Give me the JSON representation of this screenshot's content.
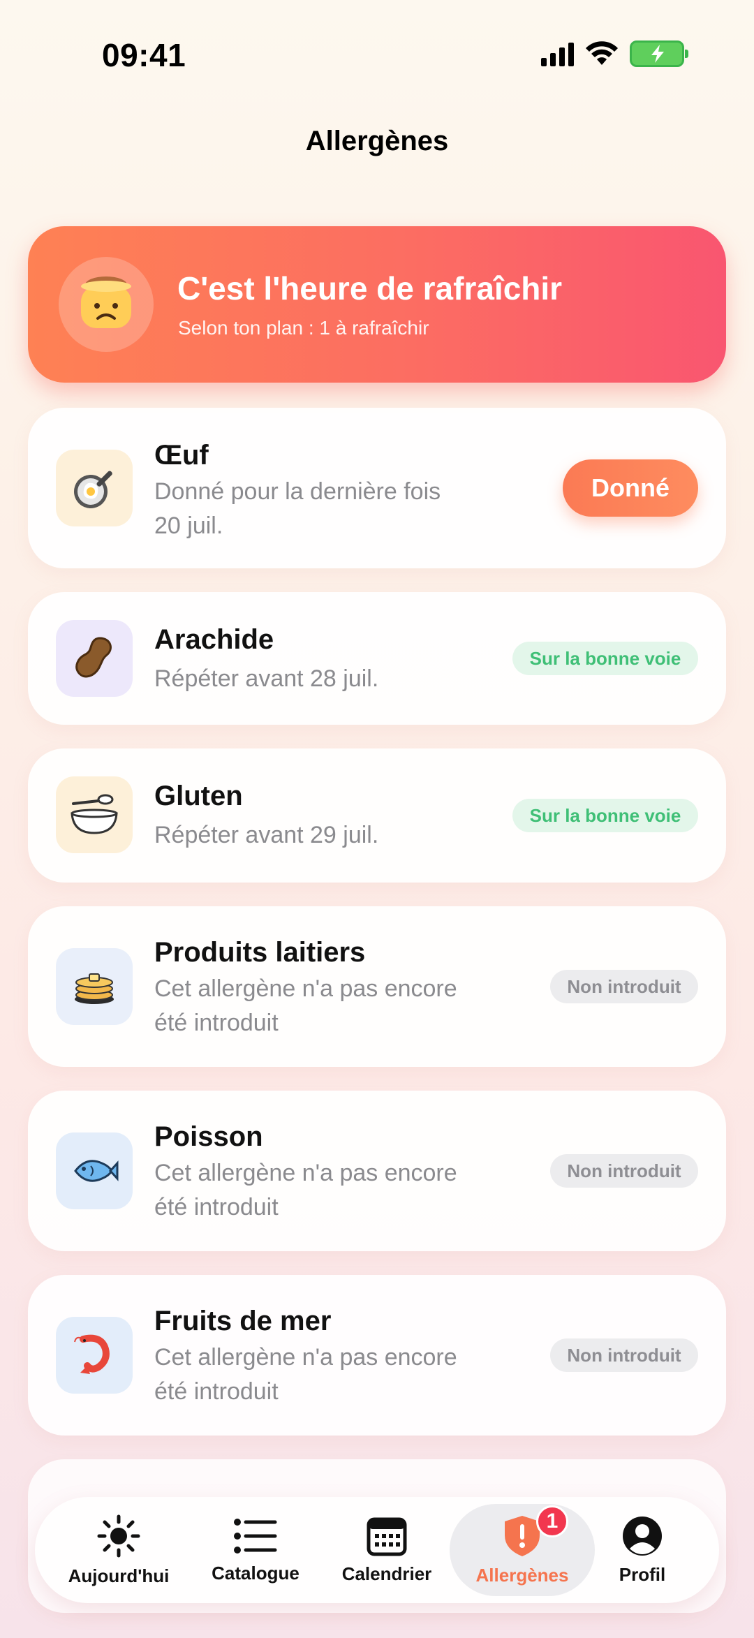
{
  "status_bar": {
    "time": "09:41"
  },
  "header": {
    "title": "Allergènes"
  },
  "banner": {
    "title": "C'est l'heure de rafraîchir",
    "subtitle": "Selon ton plan : 1 à rafraîchir",
    "icon": "sad-face-icon"
  },
  "allergens": [
    {
      "name": "Œuf",
      "desc_line1": "Donné pour la dernière fois",
      "desc_line2": "20 juil.",
      "action": "Donné",
      "icon": "frying-pan-egg-icon",
      "icon_bg": "#fdf0d9"
    },
    {
      "name": "Arachide",
      "desc_line1": "Répéter avant 28 juil.",
      "status": "Sur la bonne voie",
      "icon": "peanut-icon",
      "icon_bg": "#ede8fb"
    },
    {
      "name": "Gluten",
      "desc_line1": "Répéter avant 29 juil.",
      "status": "Sur la bonne voie",
      "icon": "bowl-spoon-icon",
      "icon_bg": "#fdf0d9"
    },
    {
      "name": "Produits laitiers",
      "desc_line1": "Cet allergène n'a pas encore",
      "desc_line2": "été introduit",
      "status": "Non introduit",
      "icon": "pancakes-icon",
      "icon_bg": "#e9effa"
    },
    {
      "name": "Poisson",
      "desc_line1": "Cet allergène n'a pas encore",
      "desc_line2": "été introduit",
      "status": "Non introduit",
      "icon": "fish-icon",
      "icon_bg": "#e3edfa"
    },
    {
      "name": "Fruits de mer",
      "desc_line1": "Cet allergène n'a pas encore",
      "desc_line2": "été introduit",
      "status": "Non introduit",
      "icon": "shrimp-icon",
      "icon_bg": "#e3edfa"
    }
  ],
  "tabbar": {
    "tabs": [
      {
        "label": "Aujourd'hui",
        "icon": "sun-icon"
      },
      {
        "label": "Catalogue",
        "icon": "list-icon"
      },
      {
        "label": "Calendrier",
        "icon": "calendar-icon"
      },
      {
        "label": "Allergènes",
        "icon": "shield-alert-icon",
        "badge": "1",
        "active": true
      },
      {
        "label": "Profil",
        "icon": "profile-icon"
      }
    ]
  },
  "colors": {
    "accent": "#f5744e",
    "banner_start": "#fe8154",
    "banner_end": "#f95670",
    "on_track_text": "#3fbf76",
    "badge": "#f2374f"
  }
}
